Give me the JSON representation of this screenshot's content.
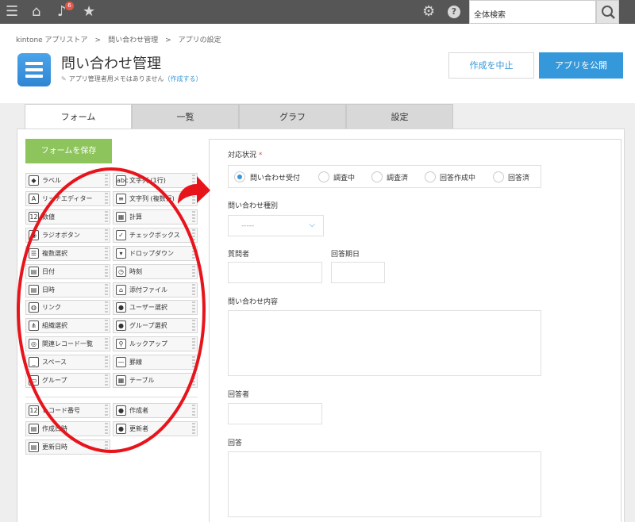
{
  "topbar": {
    "search_placeholder": "全体検索",
    "notification_count": "6",
    "icons": [
      "menu-icon",
      "home-icon",
      "bell-icon",
      "star-icon",
      "gear-icon",
      "help-icon",
      "search-icon"
    ]
  },
  "breadcrumb": "kintone アプリストア　>　問い合わせ管理　>　アプリの設定",
  "app": {
    "title": "問い合わせ管理",
    "memo_text": "アプリ管理者用メモはありません",
    "memo_link": "（作成する）"
  },
  "actions": {
    "cancel": "作成を中止",
    "publish": "アプリを公開"
  },
  "tabs": [
    "フォーム",
    "一覧",
    "グラフ",
    "設定"
  ],
  "palette": {
    "save_label": "フォームを保存",
    "fields": [
      {
        "label": "ラベル",
        "icon": "◆"
      },
      {
        "label": "文字列 (1行)",
        "icon": "abc"
      },
      {
        "label": "リッチエディター",
        "icon": "A"
      },
      {
        "label": "文字列 (複数行)",
        "icon": "≡"
      },
      {
        "label": "数値",
        "icon": "12"
      },
      {
        "label": "計算",
        "icon": "▦"
      },
      {
        "label": "ラジオボタン",
        "icon": "◉"
      },
      {
        "label": "チェックボックス",
        "icon": "✓"
      },
      {
        "label": "複数選択",
        "icon": "☰"
      },
      {
        "label": "ドロップダウン",
        "icon": "▾"
      },
      {
        "label": "日付",
        "icon": "▤"
      },
      {
        "label": "時刻",
        "icon": "◷"
      },
      {
        "label": "日時",
        "icon": "▤"
      },
      {
        "label": "添付ファイル",
        "icon": "⌂"
      },
      {
        "label": "リンク",
        "icon": "◍"
      },
      {
        "label": "ユーザー選択",
        "icon": "●"
      },
      {
        "label": "組織選択",
        "icon": "⋔"
      },
      {
        "label": "グループ選択",
        "icon": "●"
      },
      {
        "label": "関連レコード一覧",
        "icon": "◎"
      },
      {
        "label": "ルックアップ",
        "icon": "⚲"
      },
      {
        "label": "スペース",
        "icon": "_"
      },
      {
        "label": "罫線",
        "icon": "—"
      },
      {
        "label": "グループ",
        "icon": "▭"
      },
      {
        "label": "テーブル",
        "icon": "▦"
      }
    ],
    "system_fields": [
      {
        "label": "レコード番号",
        "icon": "12"
      },
      {
        "label": "作成者",
        "icon": "●"
      },
      {
        "label": "作成日時",
        "icon": "▤"
      },
      {
        "label": "更新者",
        "icon": "●"
      },
      {
        "label": "更新日時",
        "icon": "▤"
      }
    ]
  },
  "form": {
    "status_label": "対応状況",
    "required_mark": "*",
    "status_options": [
      "問い合わせ受付",
      "調査中",
      "調査済",
      "回答作成中",
      "回答済"
    ],
    "selected_option": "問い合わせ受付",
    "type_label": "問い合わせ種別",
    "type_value": "-----",
    "questioner_label": "質問者",
    "due_label": "回答期日",
    "content_label": "問い合わせ内容",
    "responder_label": "回答者",
    "answer_label": "回答"
  },
  "annotation": {
    "color": "#e8141b"
  }
}
